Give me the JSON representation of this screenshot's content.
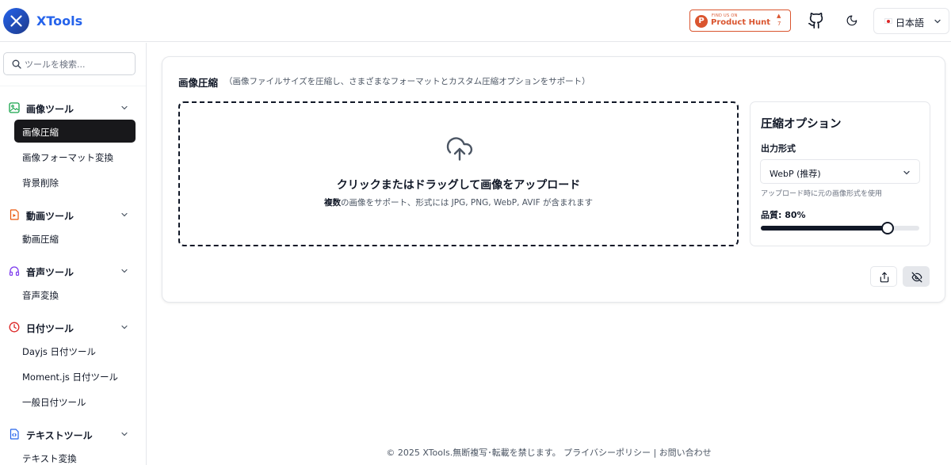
{
  "header": {
    "brand": "XTools",
    "product_hunt": {
      "small": "FIND US ON",
      "big": "Product Hunt",
      "count": "7"
    },
    "language": "日本語",
    "colors": {
      "brand": "#2563eb",
      "product_hunt": "#da552f"
    }
  },
  "sidebar": {
    "search_placeholder": "ツールを検索...",
    "categories": [
      {
        "label": "画像ツール",
        "icon": "image-icon",
        "items": [
          "画像圧縮",
          "画像フォーマット変換",
          "背景削除"
        ]
      },
      {
        "label": "動画ツール",
        "icon": "video-icon",
        "items": [
          "動画圧縮"
        ]
      },
      {
        "label": "音声ツール",
        "icon": "headphones-icon",
        "items": [
          "音声変換"
        ]
      },
      {
        "label": "日付ツール",
        "icon": "clock-icon",
        "items": [
          "Dayjs 日付ツール",
          "Moment.js 日付ツール",
          "一般日付ツール"
        ]
      },
      {
        "label": "テキストツール",
        "icon": "code-file-icon",
        "items": [
          "テキスト変換"
        ]
      }
    ],
    "active_item": "画像圧縮"
  },
  "main": {
    "title": "画像圧縮",
    "description": "（画像ファイルサイズを圧縮し、さまざまなフォーマットとカスタム圧縮オプションをサポート）",
    "upload": {
      "title": "クリックまたはドラッグして画像をアップロード",
      "subtitle_bold": "複数",
      "subtitle_rest": "の画像をサポート、形式には JPG, PNG, WebP, AVIF が含まれます"
    },
    "options": {
      "title": "圧縮オプション",
      "output_label": "出力形式",
      "output_value": "WebP (推荐)",
      "output_hint": "アップロード時に元の画像形式を使用",
      "quality_label": "品質: 80%",
      "quality_value": 0.8
    }
  },
  "footer": "© 2025 XTools.無断複写･転載を禁じます。 プライバシーポリシー | お問い合わせ"
}
